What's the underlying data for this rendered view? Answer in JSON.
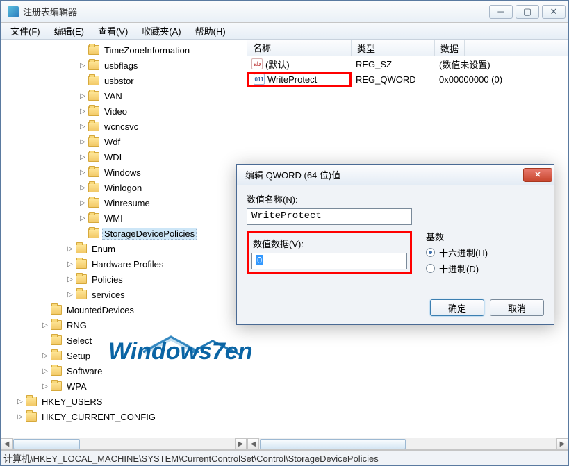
{
  "window": {
    "title": "注册表编辑器"
  },
  "menu": {
    "file": "文件(F)",
    "edit": "编辑(E)",
    "view": "查看(V)",
    "favorites": "收藏夹(A)",
    "help": "帮助(H)"
  },
  "tree": {
    "items": [
      {
        "label": "TimeZoneInformation",
        "indent": 6,
        "exp": "none",
        "sel": false
      },
      {
        "label": "usbflags",
        "indent": 6,
        "exp": "closed",
        "sel": false
      },
      {
        "label": "usbstor",
        "indent": 6,
        "exp": "none",
        "sel": false
      },
      {
        "label": "VAN",
        "indent": 6,
        "exp": "closed",
        "sel": false
      },
      {
        "label": "Video",
        "indent": 6,
        "exp": "closed",
        "sel": false
      },
      {
        "label": "wcncsvc",
        "indent": 6,
        "exp": "closed",
        "sel": false
      },
      {
        "label": "Wdf",
        "indent": 6,
        "exp": "closed",
        "sel": false
      },
      {
        "label": "WDI",
        "indent": 6,
        "exp": "closed",
        "sel": false
      },
      {
        "label": "Windows",
        "indent": 6,
        "exp": "closed",
        "sel": false
      },
      {
        "label": "Winlogon",
        "indent": 6,
        "exp": "closed",
        "sel": false
      },
      {
        "label": "Winresume",
        "indent": 6,
        "exp": "closed",
        "sel": false
      },
      {
        "label": "WMI",
        "indent": 6,
        "exp": "closed",
        "sel": false
      },
      {
        "label": "StorageDevicePolicies",
        "indent": 6,
        "exp": "none",
        "sel": true
      },
      {
        "label": "Enum",
        "indent": 5,
        "exp": "closed",
        "sel": false
      },
      {
        "label": "Hardware Profiles",
        "indent": 5,
        "exp": "closed",
        "sel": false
      },
      {
        "label": "Policies",
        "indent": 5,
        "exp": "closed",
        "sel": false
      },
      {
        "label": "services",
        "indent": 5,
        "exp": "closed",
        "sel": false
      },
      {
        "label": "MountedDevices",
        "indent": 3,
        "exp": "none",
        "sel": false
      },
      {
        "label": "RNG",
        "indent": 3,
        "exp": "closed",
        "sel": false
      },
      {
        "label": "Select",
        "indent": 3,
        "exp": "none",
        "sel": false
      },
      {
        "label": "Setup",
        "indent": 3,
        "exp": "closed",
        "sel": false
      },
      {
        "label": "Software",
        "indent": 3,
        "exp": "closed",
        "sel": false
      },
      {
        "label": "WPA",
        "indent": 3,
        "exp": "closed",
        "sel": false
      },
      {
        "label": "HKEY_USERS",
        "indent": 1,
        "exp": "closed",
        "sel": false
      },
      {
        "label": "HKEY_CURRENT_CONFIG",
        "indent": 1,
        "exp": "closed",
        "sel": false
      }
    ]
  },
  "list": {
    "headers": {
      "name": "名称",
      "type": "类型",
      "data": "数据"
    },
    "rows": [
      {
        "icon": "str",
        "name": "(默认)",
        "type": "REG_SZ",
        "data": "(数值未设置)",
        "highlight": false
      },
      {
        "icon": "bin",
        "name": "WriteProtect",
        "type": "REG_QWORD",
        "data": "0x00000000 (0)",
        "highlight": true
      }
    ]
  },
  "statusbar": "计算机\\HKEY_LOCAL_MACHINE\\SYSTEM\\CurrentControlSet\\Control\\StorageDevicePolicies",
  "dialog": {
    "title": "编辑 QWORD (64 位)值",
    "name_label": "数值名称(N):",
    "name_value": "WriteProtect",
    "data_label": "数值数据(V):",
    "data_value": "0",
    "radix_label": "基数",
    "hex_label": "十六进制(H)",
    "dec_label": "十进制(D)",
    "ok": "确定",
    "cancel": "取消"
  },
  "watermark": "Windows7en"
}
